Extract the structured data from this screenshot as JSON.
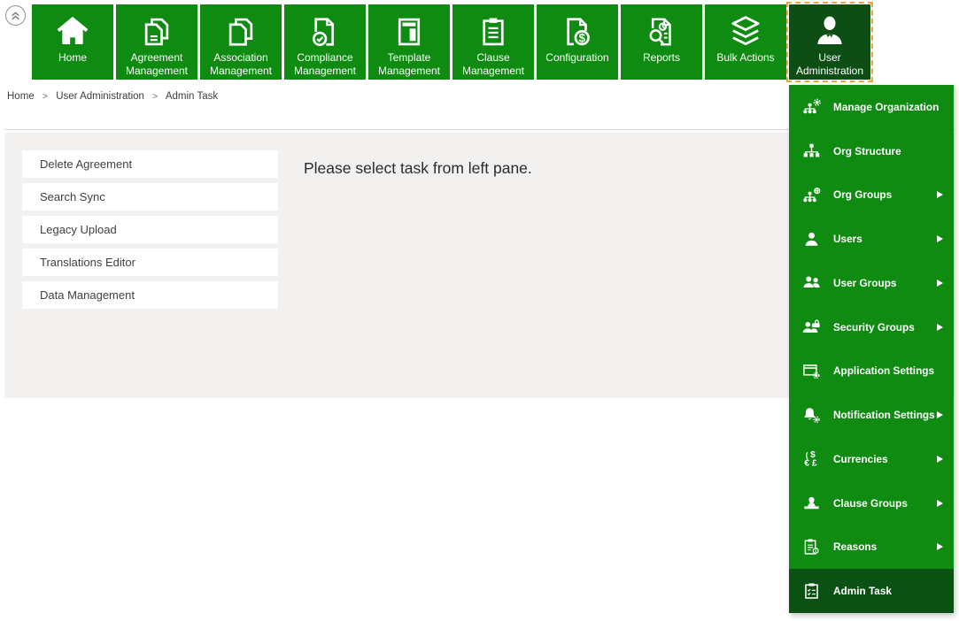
{
  "window": {
    "collapse_icon": "double-chevron-up"
  },
  "nav_tiles": [
    {
      "label": "Home",
      "icon": "home-icon",
      "selected": false
    },
    {
      "label": "Agreement Management",
      "icon": "agreement-management-icon",
      "selected": false
    },
    {
      "label": "Association Management",
      "icon": "association-management-icon",
      "selected": false
    },
    {
      "label": "Compliance Management",
      "icon": "compliance-management-icon",
      "selected": false
    },
    {
      "label": "Template Management",
      "icon": "template-management-icon",
      "selected": false
    },
    {
      "label": "Clause Management",
      "icon": "clause-management-icon",
      "selected": false
    },
    {
      "label": "Configuration",
      "icon": "configuration-icon",
      "selected": false
    },
    {
      "label": "Reports",
      "icon": "reports-icon",
      "selected": false
    },
    {
      "label": "Bulk Actions",
      "icon": "bulk-actions-icon",
      "selected": false
    },
    {
      "label": "User Administration",
      "icon": "user-administration-icon",
      "selected": true
    }
  ],
  "breadcrumb": {
    "separator": ">",
    "items": [
      "Home",
      "User Administration",
      "Admin Task"
    ]
  },
  "task_pane": {
    "items": [
      "Delete Agreement",
      "Search Sync",
      "Legacy Upload",
      "Translations Editor",
      "Data Management"
    ]
  },
  "main": {
    "message": "Please select task from left pane."
  },
  "user_admin_menu": {
    "items": [
      {
        "label": "Manage Organization",
        "icon": "manage-organization-icon",
        "has_submenu": false,
        "selected": false
      },
      {
        "label": "Org Structure",
        "icon": "org-structure-icon",
        "has_submenu": false,
        "selected": false
      },
      {
        "label": "Org Groups",
        "icon": "org-groups-icon",
        "has_submenu": true,
        "selected": false
      },
      {
        "label": "Users",
        "icon": "users-icon",
        "has_submenu": true,
        "selected": false
      },
      {
        "label": "User Groups",
        "icon": "user-groups-icon",
        "has_submenu": true,
        "selected": false
      },
      {
        "label": "Security Groups",
        "icon": "security-groups-icon",
        "has_submenu": true,
        "selected": false
      },
      {
        "label": "Application Settings",
        "icon": "application-settings-icon",
        "has_submenu": false,
        "selected": false
      },
      {
        "label": "Notification Settings",
        "icon": "notification-settings-icon",
        "has_submenu": true,
        "selected": false
      },
      {
        "label": "Currencies",
        "icon": "currencies-icon",
        "has_submenu": true,
        "selected": false
      },
      {
        "label": "Clause Groups",
        "icon": "clause-groups-icon",
        "has_submenu": true,
        "selected": false
      },
      {
        "label": "Reasons",
        "icon": "reasons-icon",
        "has_submenu": true,
        "selected": false
      },
      {
        "label": "Admin Task",
        "icon": "admin-task-icon",
        "has_submenu": false,
        "selected": true
      }
    ]
  },
  "colors": {
    "tile_green": "#0e8b10",
    "selected_dark_green": "#0b5114",
    "selected_tile_green": "#0c4e14",
    "focus_dashed_border": "#eda33c",
    "content_background": "#f2f1ef",
    "divider_line": "#dadad7",
    "text_dark": "#2b2b2b",
    "white": "#ffffff"
  }
}
